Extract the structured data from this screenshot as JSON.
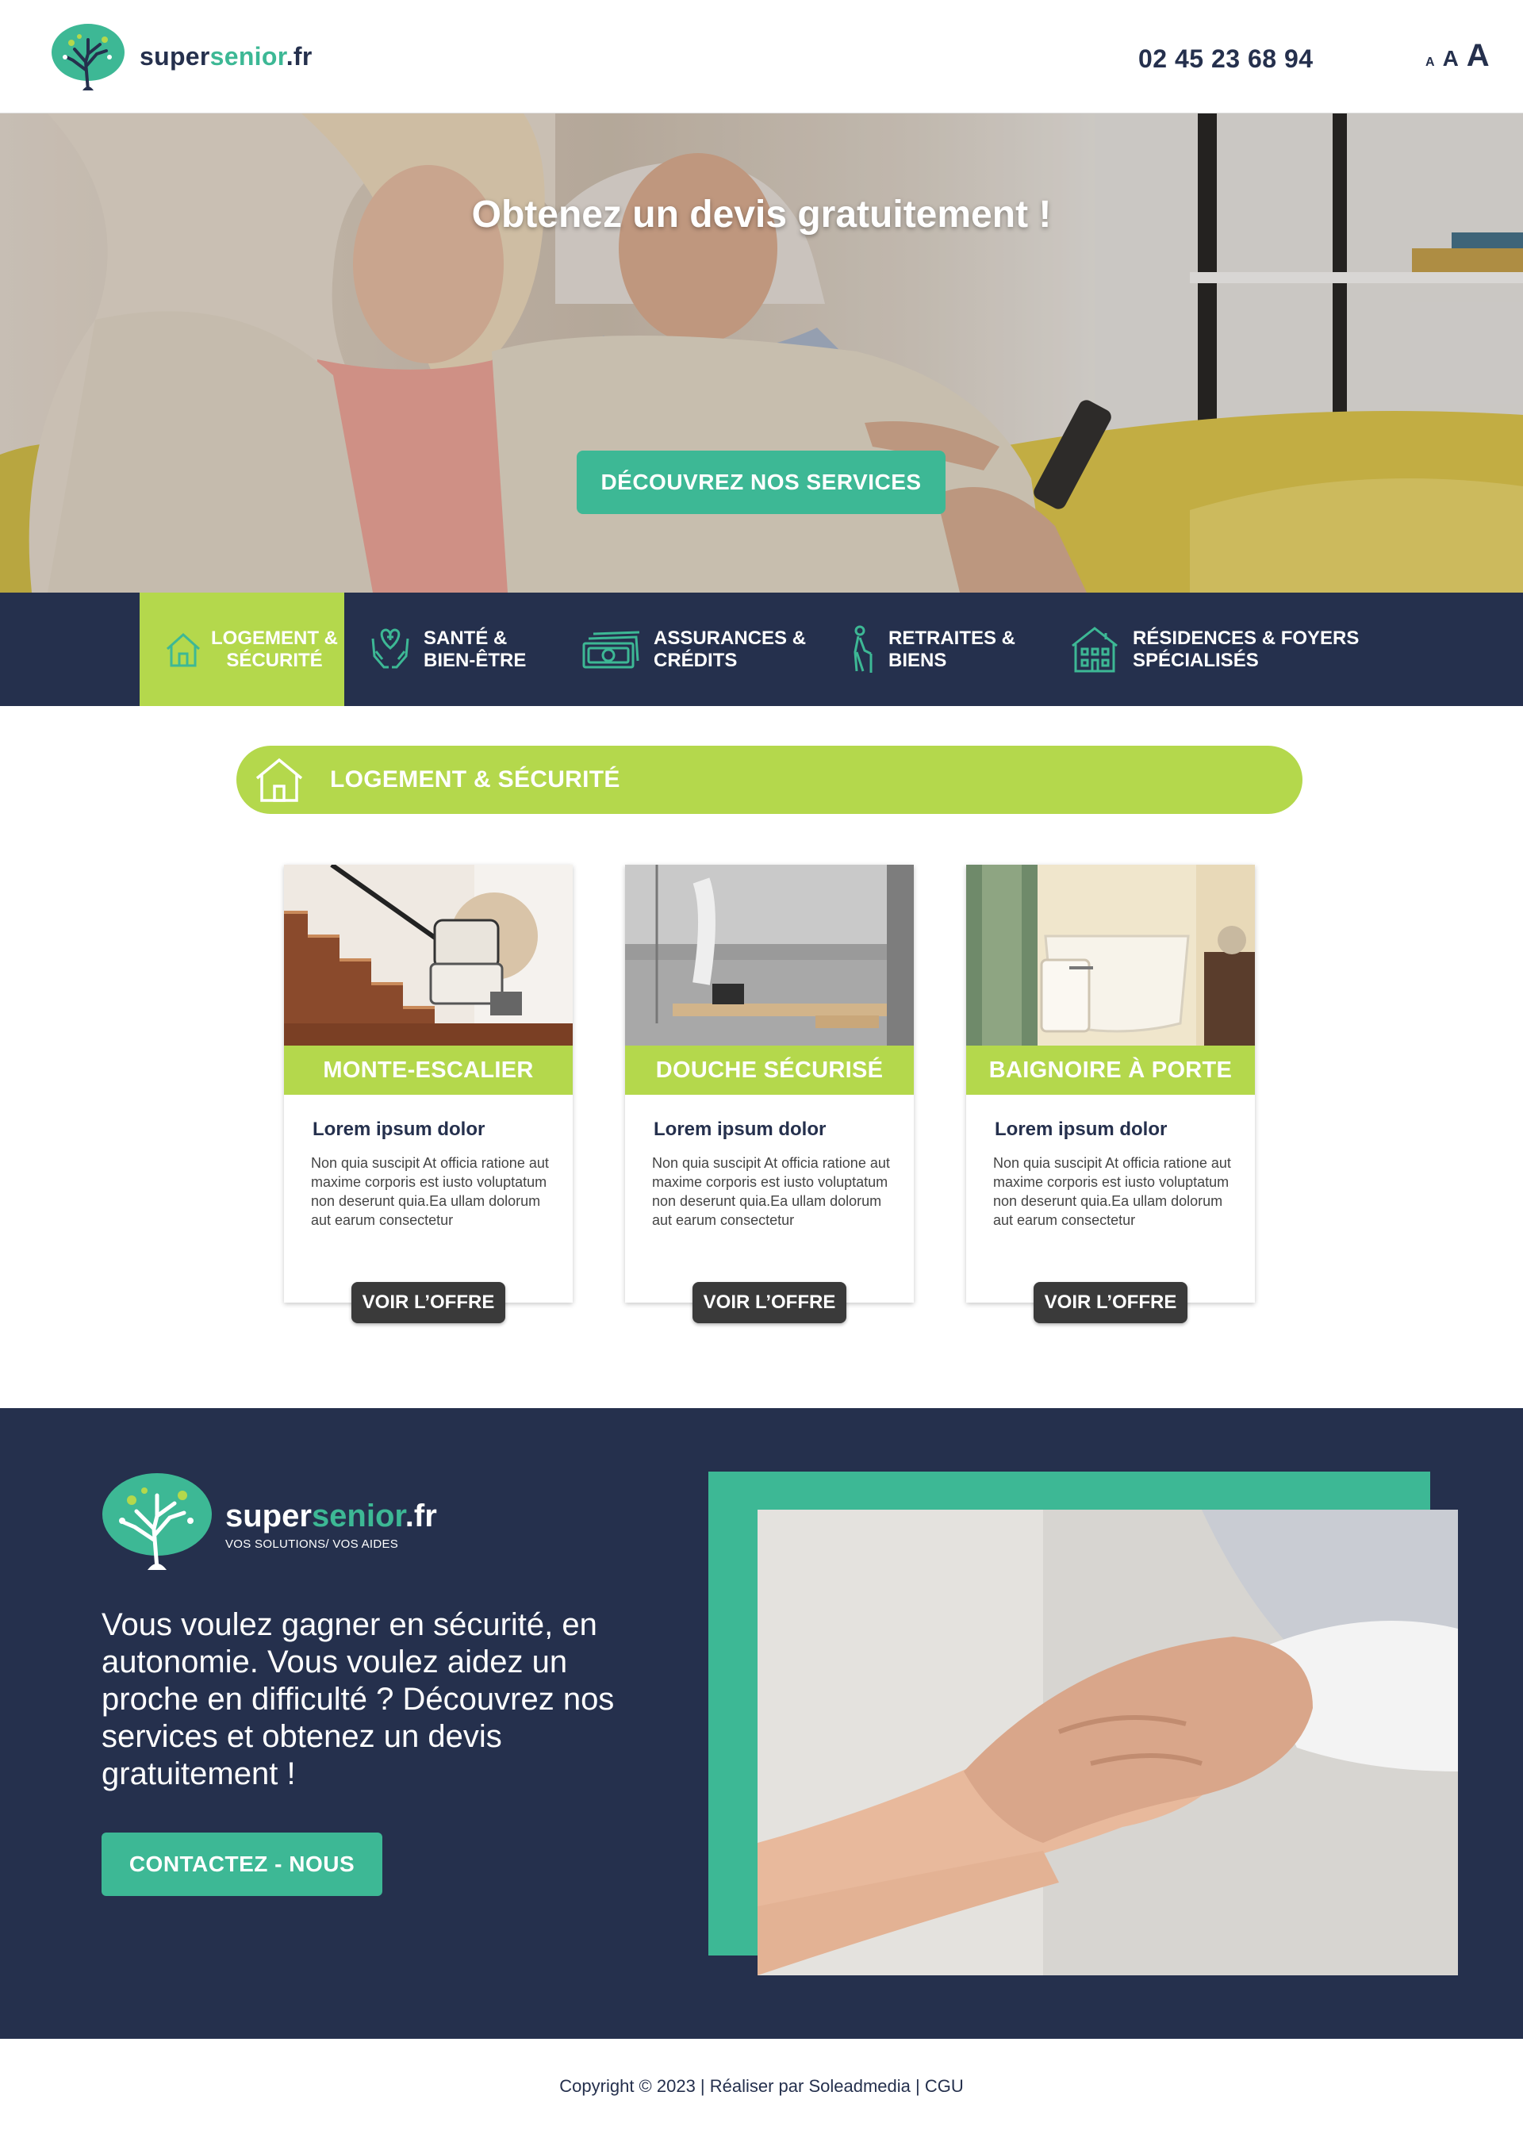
{
  "header": {
    "logo": {
      "prefix": "super",
      "highlight": "senior",
      "suffix": ".fr"
    },
    "phone": "02 45 23 68 94",
    "font_size_controls": [
      "A",
      "A",
      "A"
    ]
  },
  "hero": {
    "title": "Obtenez un devis gratuitement !",
    "button_label": "DÉCOUVREZ NOS SERVICES"
  },
  "categories": [
    {
      "label": "LOGEMENT &\nSÉCURITÉ",
      "icon": "house-icon",
      "active": true
    },
    {
      "label": "SANTÉ &\nBIEN-ÊTRE",
      "icon": "heart-hands-icon",
      "active": false
    },
    {
      "label": "ASSURANCES &\nCRÉDITS",
      "icon": "money-icon",
      "active": false
    },
    {
      "label": "RETRAITES &\nBIENS",
      "icon": "elderly-cane-icon",
      "active": false
    },
    {
      "label": "RÉSIDENCES & FOYERS\nSPÉCIALISÉS",
      "icon": "building-icon",
      "active": false
    }
  ],
  "section": {
    "title": "LOGEMENT & SÉCURITÉ",
    "icon": "house-icon"
  },
  "cards": [
    {
      "title": "MONTE-ESCALIER",
      "subtitle": "Lorem ipsum dolor",
      "description": "Non quia suscipit At officia ratione aut maxime corporis est iusto voluptatum non deserunt quia.Ea ullam dolorum aut earum consectetur",
      "button_label": "VOIR L’OFFRE"
    },
    {
      "title": "DOUCHE SÉCURISÉ",
      "subtitle": "Lorem ipsum dolor",
      "description": "Non quia suscipit At officia ratione aut maxime corporis est iusto voluptatum non deserunt quia.Ea ullam dolorum aut earum consectetur",
      "button_label": "VOIR L’OFFRE"
    },
    {
      "title": "BAIGNOIRE À PORTE",
      "subtitle": "Lorem ipsum dolor",
      "description": "Non quia suscipit At officia ratione aut maxime corporis est iusto voluptatum non deserunt quia.Ea ullam dolorum aut earum consectetur",
      "button_label": "VOIR L’OFFRE"
    }
  ],
  "promo": {
    "logo": {
      "prefix": "super",
      "highlight": "senior",
      "suffix": ".fr"
    },
    "tagline": "VOS SOLUTIONS/ VOS AIDES",
    "text": "Vous voulez gagner en sécurité, en autonomie. Vous voulez aidez un proche en difficulté ? Découvrez nos services et obtenez un devis gratuitement !",
    "button_label": "CONTACTEZ - NOUS"
  },
  "footer": {
    "copyright": "Copyright © 2023 | Réaliser par Soleadmedia | CGU"
  },
  "colors": {
    "navy": "#25304d",
    "green": "#3db895",
    "lime": "#b4d84c",
    "dark_button": "#3a3a3a"
  }
}
